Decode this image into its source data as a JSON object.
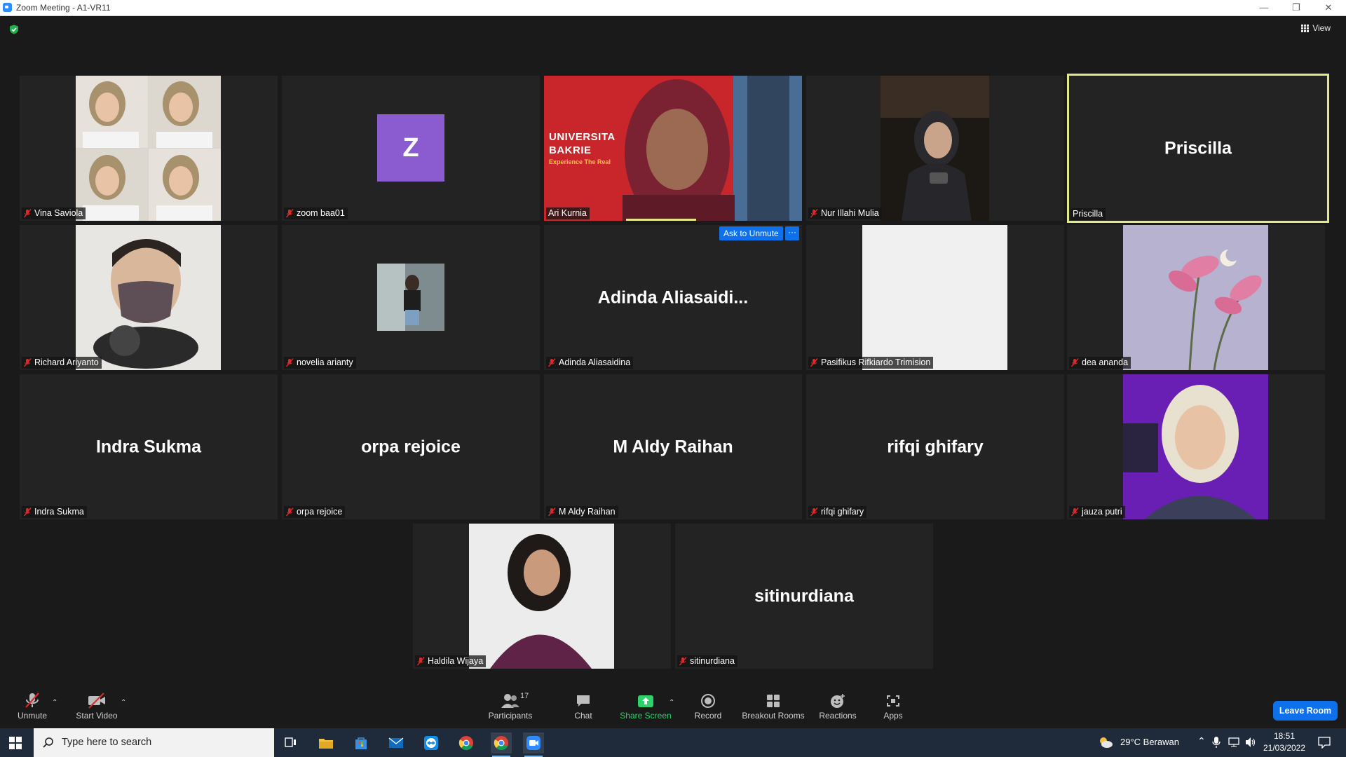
{
  "window": {
    "title": "Zoom Meeting - A1-VR11",
    "minimize": "—",
    "restore": "❐",
    "close": "✕"
  },
  "view_label": "View",
  "tiles": [
    {
      "label": "Vina Saviola"
    },
    {
      "label": "zoom baa01",
      "initial": "Z"
    },
    {
      "label": "Ari Kurnia",
      "banner_line1": "UNIVERSITA",
      "banner_line2": "BAKRIE",
      "banner_line3": "Experience The Real"
    },
    {
      "label": "Nur Illahi Mulia"
    },
    {
      "label": "Priscilla",
      "big": "Priscilla"
    },
    {
      "label": "Richard Ariyanto"
    },
    {
      "label": "novelia arianty"
    },
    {
      "label": "Adinda Aliasaidina",
      "big": "Adinda  Aliasaidi..."
    },
    {
      "label": "Pasifikus Rifkiardo Trimision"
    },
    {
      "label": "dea ananda"
    },
    {
      "label": "Indra Sukma",
      "big": "Indra Sukma"
    },
    {
      "label": "orpa rejoice",
      "big": "orpa rejoice"
    },
    {
      "label": "M Aldy Raihan",
      "big": "M Aldy Raihan"
    },
    {
      "label": "rifqi ghifary",
      "big": "rifqi ghifary"
    },
    {
      "label": "jauza putri"
    },
    {
      "label": "Haldila Wijaya"
    },
    {
      "label": "sitinurdiana",
      "big": "sitinurdiana"
    }
  ],
  "ask_to_unmute": "Ask to Unmute",
  "more": "···",
  "toolbar": {
    "unmute": "Unmute",
    "start_video": "Start Video",
    "participants": "Participants",
    "participants_count": "17",
    "chat": "Chat",
    "share_screen": "Share Screen",
    "record": "Record",
    "breakout_rooms": "Breakout Rooms",
    "reactions": "Reactions",
    "apps": "Apps",
    "leave_room": "Leave Room"
  },
  "taskbar": {
    "search_placeholder": "Type here to search",
    "weather": "29°C  Berawan",
    "time": "18:51",
    "date": "21/03/2022"
  },
  "colors": {
    "accent": "#0e71eb",
    "active_speaker": "#e3e88b",
    "share_green": "#2fd16a",
    "avatar": "#8a5cd0"
  }
}
